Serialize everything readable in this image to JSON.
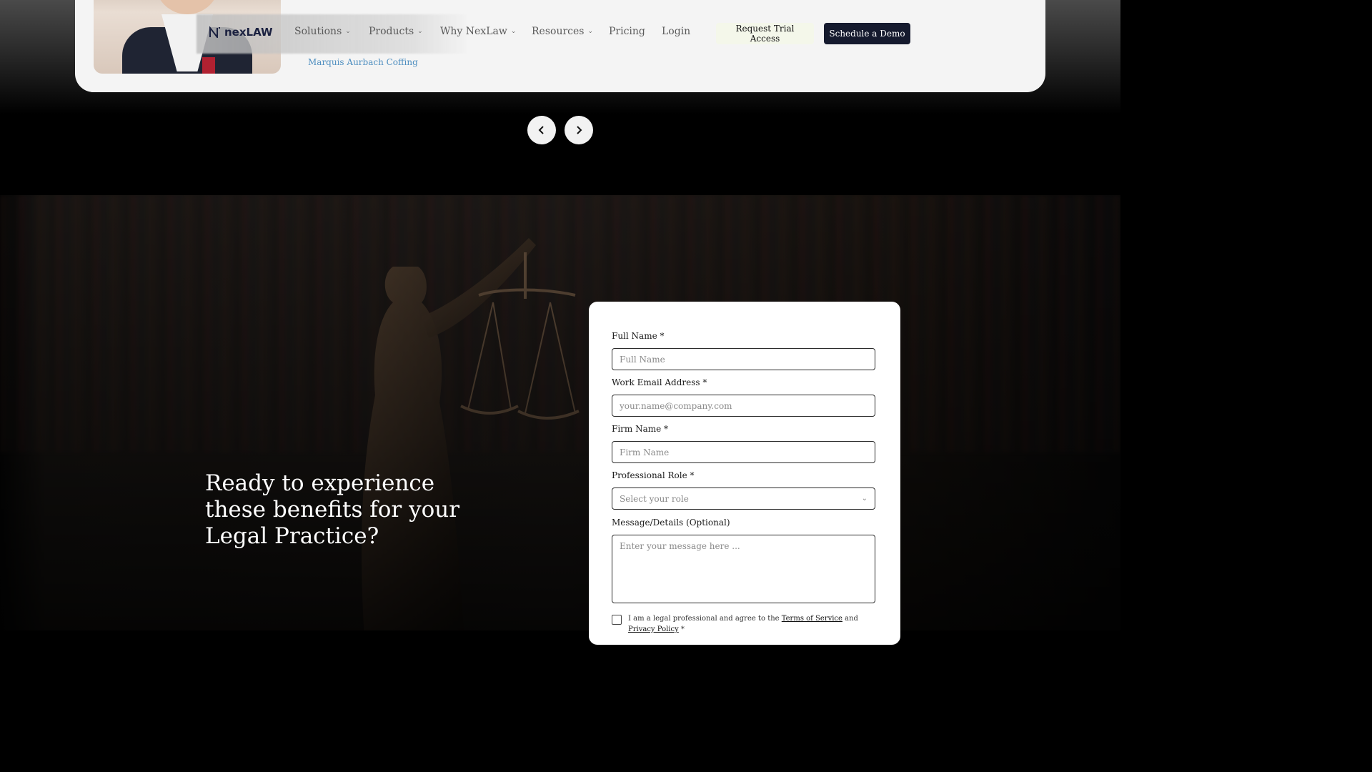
{
  "testimonial": {
    "author": "Marquis Aurbach Coffing"
  },
  "nav": {
    "logo_text": "nexLAW",
    "items": [
      {
        "label": "Solutions",
        "has_dropdown": true
      },
      {
        "label": "Products",
        "has_dropdown": true
      },
      {
        "label": "Why NexLaw",
        "has_dropdown": true
      },
      {
        "label": "Resources",
        "has_dropdown": true
      },
      {
        "label": "Pricing",
        "has_dropdown": false
      },
      {
        "label": "Login",
        "has_dropdown": false
      }
    ],
    "trial_label": "Request Trial Access",
    "demo_label": "Schedule a Demo"
  },
  "carousel": {
    "prev_icon": "chevron-left-icon",
    "next_icon": "chevron-right-icon"
  },
  "hero": {
    "heading": "Ready to experience these benefits for your Legal Practice?"
  },
  "form": {
    "full_name_label": "Full Name *",
    "full_name_placeholder": "Full Name",
    "email_label": "Work Email Address *",
    "email_placeholder": "your.name@company.com",
    "firm_label": "Firm Name *",
    "firm_placeholder": "Firm Name",
    "role_label": "Professional Role *",
    "role_placeholder": "Select your role",
    "message_label": "Message/Details (Optional)",
    "message_placeholder": "Enter your message here ...",
    "consent_prefix": "I am a legal professional and agree to the ",
    "terms_label": "Terms of Service",
    "consent_and": " and ",
    "privacy_label": "Privacy Policy",
    "consent_suffix": " *"
  },
  "colors": {
    "demo_button_bg": "#151a2e",
    "trial_button_bg": "#f4f7ea",
    "author_link": "#4f8fc0"
  }
}
